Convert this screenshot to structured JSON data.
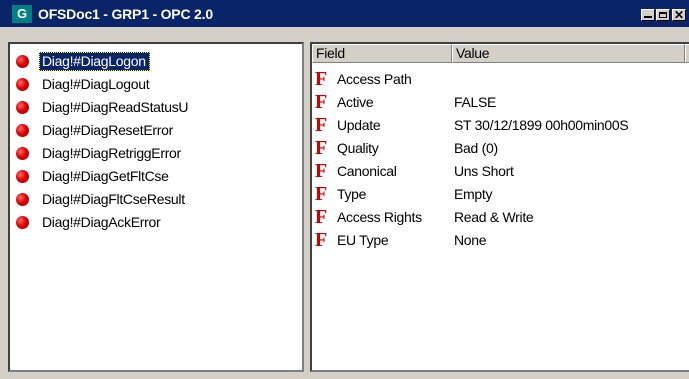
{
  "window": {
    "badge": "G",
    "title": "OFSDoc1 - GRP1 - OPC 2.0",
    "close_glyph": "✕"
  },
  "items": [
    {
      "label": "Diag!#DiagLogon",
      "selected": true
    },
    {
      "label": "Diag!#DiagLogout"
    },
    {
      "label": "Diag!#DiagReadStatusU"
    },
    {
      "label": "Diag!#DiagResetError"
    },
    {
      "label": "Diag!#DiagRetriggError"
    },
    {
      "label": "Diag!#DiagGetFltCse"
    },
    {
      "label": "Diag!#DiagFltCseResult"
    },
    {
      "label": "Diag!#DiagAckError"
    }
  ],
  "table": {
    "headers": [
      "Field",
      "Value"
    ],
    "icon_glyph": "F",
    "rows": [
      {
        "field": "Access Path",
        "value": ""
      },
      {
        "field": "Active",
        "value": "FALSE"
      },
      {
        "field": "Update",
        "value": "ST 30/12/1899 00h00min00S"
      },
      {
        "field": "Quality",
        "value": "Bad (0)"
      },
      {
        "field": "Canonical",
        "value": "Uns Short"
      },
      {
        "field": "Type",
        "value": "Empty"
      },
      {
        "field": "Access Rights",
        "value": "Read & Write"
      },
      {
        "field": "EU Type",
        "value": "None"
      }
    ]
  },
  "colors": {
    "titlebar": "#0a246a",
    "badge": "#008080",
    "status_dot": "#e00000",
    "f_icon": "#cc0000",
    "selection": "#0a246a"
  },
  "icons": {
    "status": "red-status-dot-icon",
    "field": "red-f-property-icon"
  }
}
